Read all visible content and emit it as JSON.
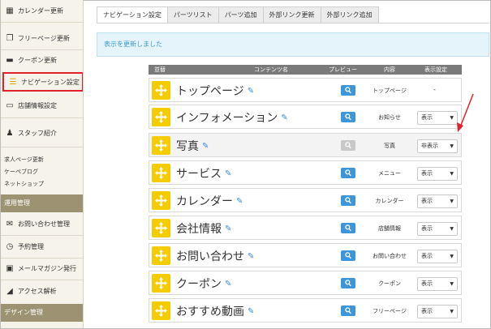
{
  "sidebar": {
    "items_top": [
      {
        "label": "カレンダー更新",
        "icon": "calendar-icon"
      },
      {
        "label": "フリーページ更新",
        "icon": "pages-icon"
      },
      {
        "label": "クーポン更新",
        "icon": "coupon-icon"
      },
      {
        "label": "ナビゲーション設定",
        "icon": "nav-list-icon"
      },
      {
        "label": "店舗情報設定",
        "icon": "laptop-icon"
      },
      {
        "label": "スタッフ紹介",
        "icon": "staff-icon"
      }
    ],
    "small_links": [
      "求人ページ更新",
      "ケーペブログ",
      "ネットショップ"
    ],
    "section_operation": "運用管理",
    "items_operation": [
      {
        "label": "お問い合わせ管理",
        "icon": "mail-icon"
      },
      {
        "label": "予約管理",
        "icon": "clock-icon"
      },
      {
        "label": "メールマガジン発行",
        "icon": "newsletter-icon"
      },
      {
        "label": "アクセス解析",
        "icon": "chart-icon"
      }
    ],
    "section_design": "デザイン管理"
  },
  "tabs": [
    "ナビゲーション設定",
    "パーツリスト",
    "パーツ追加",
    "外部リンク更新",
    "外部リンク追加"
  ],
  "notice": "表示を更新しました",
  "table": {
    "headers": {
      "order": "並替",
      "content": "コンテンツ名",
      "preview": "プレビュー",
      "type": "内容",
      "display": "表示設定"
    },
    "rows": [
      {
        "name": "トップページ",
        "type": "トップページ",
        "display": "-",
        "preview_enabled": true
      },
      {
        "name": "インフォメーション",
        "type": "お知らせ",
        "display": "表示",
        "preview_enabled": true
      },
      {
        "name": "写真",
        "type": "写真",
        "display": "非表示",
        "preview_enabled": false
      },
      {
        "name": "サービス",
        "type": "メニュー",
        "display": "表示",
        "preview_enabled": true
      },
      {
        "name": "カレンダー",
        "type": "カレンダー",
        "display": "表示",
        "preview_enabled": true
      },
      {
        "name": "会社情報",
        "type": "店舗情報",
        "display": "表示",
        "preview_enabled": true
      },
      {
        "name": "お問い合わせ",
        "type": "お問い合わせ",
        "display": "表示",
        "preview_enabled": true
      },
      {
        "name": "クーポン",
        "type": "クーポン",
        "display": "表示",
        "preview_enabled": true
      },
      {
        "name": "おすすめ動画",
        "type": "フリーページ",
        "display": "表示",
        "preview_enabled": true
      }
    ]
  },
  "colors": {
    "accent_red": "#e0222a",
    "handle_yellow": "#f4cc00",
    "preview_blue": "#3d96db",
    "sidebar_section": "#9d9272"
  }
}
